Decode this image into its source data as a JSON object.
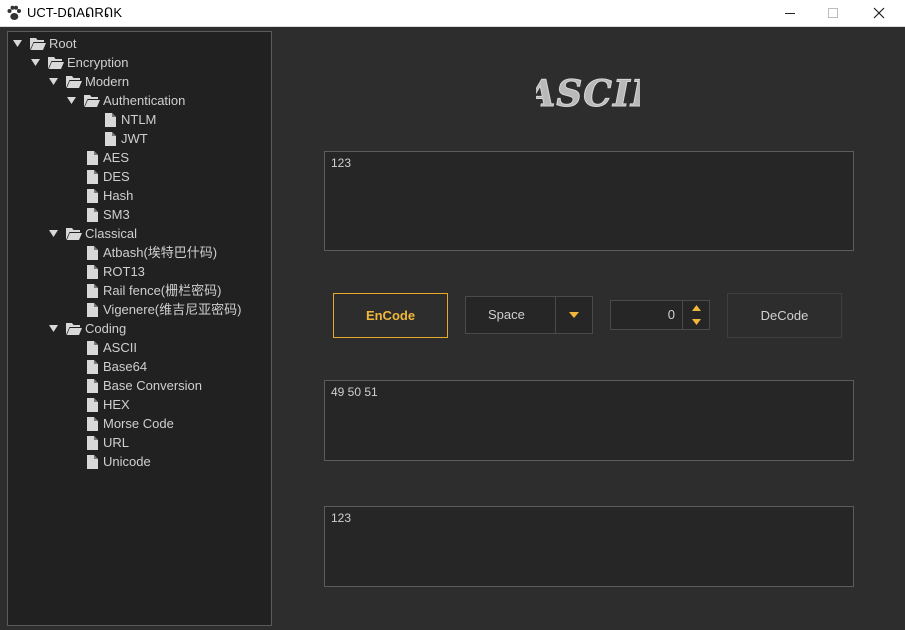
{
  "window": {
    "title": "UCT-DᕠAᕠRᕠK"
  },
  "tree": {
    "nodes": [
      {
        "label": "Root",
        "type": "folder",
        "expanded": true
      },
      {
        "label": "Encryption",
        "type": "folder",
        "expanded": true
      },
      {
        "label": "Modern",
        "type": "folder",
        "expanded": true
      },
      {
        "label": "Authentication",
        "type": "folder",
        "expanded": true
      },
      {
        "label": "NTLM",
        "type": "file"
      },
      {
        "label": "JWT",
        "type": "file"
      },
      {
        "label": "AES",
        "type": "file"
      },
      {
        "label": "DES",
        "type": "file"
      },
      {
        "label": "Hash",
        "type": "file"
      },
      {
        "label": "SM3",
        "type": "file"
      },
      {
        "label": "Classical",
        "type": "folder",
        "expanded": true
      },
      {
        "label": "Atbash(埃特巴什码)",
        "type": "file"
      },
      {
        "label": "ROT13",
        "type": "file"
      },
      {
        "label": "Rail fence(栅栏密码)",
        "type": "file"
      },
      {
        "label": "Vigenere(维吉尼亚密码)",
        "type": "file"
      },
      {
        "label": "Coding",
        "type": "folder",
        "expanded": true
      },
      {
        "label": "ASCII",
        "type": "file"
      },
      {
        "label": "Base64",
        "type": "file"
      },
      {
        "label": "Base Conversion",
        "type": "file"
      },
      {
        "label": "HEX",
        "type": "file"
      },
      {
        "label": "Morse Code",
        "type": "file"
      },
      {
        "label": "URL",
        "type": "file"
      },
      {
        "label": "Unicode",
        "type": "file"
      }
    ]
  },
  "panel": {
    "title": "ASCII",
    "input_text": "123",
    "encode_label": "EnCode",
    "separator": {
      "selected": "Space"
    },
    "offset_value": "0",
    "decode_label": "DeCode",
    "encoded_output": "49 50 51",
    "decoded_output": "123"
  },
  "colors": {
    "accent": "#f1b73a",
    "background": "#2d2d2d",
    "tree_background": "#212121"
  }
}
